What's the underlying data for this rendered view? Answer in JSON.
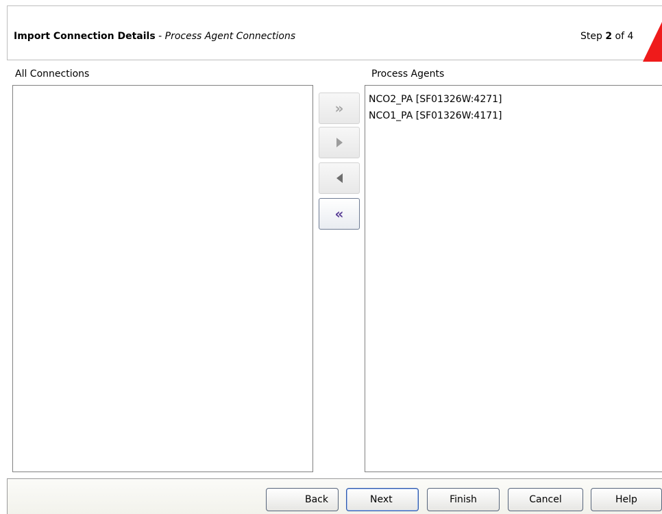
{
  "header": {
    "title_main": "Import Connection Details",
    "title_sep": " - ",
    "title_sub": "Process Agent Connections",
    "step_prefix": "Step ",
    "step_current": "2",
    "step_suffix": " of 4",
    "accent_color": "#ef1b1b"
  },
  "left_list": {
    "label": "All Connections",
    "items": []
  },
  "right_list": {
    "label": "Process Agents",
    "items": [
      "NCO2_PA [SF01326W:4271]",
      "NCO1_PA [SF01326W:4171]"
    ]
  },
  "transfer_buttons": {
    "add_all": "»",
    "remove_all": "«"
  },
  "footer": {
    "back": "Back",
    "next": "Next",
    "finish": "Finish",
    "cancel": "Cancel",
    "help": "Help"
  }
}
